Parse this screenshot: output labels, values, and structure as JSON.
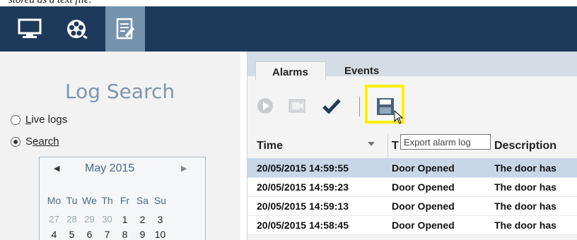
{
  "caption": {
    "text": "stored as a text file."
  },
  "toolbar_top": {
    "buttons": [
      {
        "icon": "monitor-icon"
      },
      {
        "icon": "film-reel-icon"
      },
      {
        "icon": "log-document-icon",
        "active": true
      }
    ]
  },
  "log_search": {
    "title": "Log Search",
    "live_logs_label": "ive logs",
    "live_logs_accel": "L",
    "search_label": "earch",
    "search_accel": "S",
    "selected_mode": "search"
  },
  "calendar": {
    "prev_arrow": "◀",
    "next_arrow": "▶",
    "month_label": "May 2015",
    "day_headers": [
      "Mo",
      "Tu",
      "We",
      "Th",
      "Fr",
      "Sa",
      "Su"
    ],
    "week1": [
      "27",
      "28",
      "29",
      "30",
      "1",
      "2",
      "3"
    ],
    "week2": [
      "4",
      "5",
      "6",
      "7",
      "8",
      "9",
      "10"
    ]
  },
  "tabs": [
    {
      "label": "Alarms",
      "active": true
    },
    {
      "label": "Events",
      "active": false
    }
  ],
  "alarm_toolbar": {
    "tooltip": "Export alarm log"
  },
  "grid": {
    "columns": [
      "Time",
      "T",
      "Description"
    ],
    "rows": [
      {
        "time": "20/05/2015 14:59:55",
        "type": "Door Opened",
        "description": "The door has",
        "selected": true
      },
      {
        "time": "20/05/2015 14:59:23",
        "type": "Door Opened",
        "description": "The door has",
        "selected": false
      },
      {
        "time": "20/05/2015 14:59:13",
        "type": "Door Opened",
        "description": "The door has",
        "selected": false
      },
      {
        "time": "20/05/2015 14:58:45",
        "type": "Door Opened",
        "description": "The door has",
        "selected": false
      }
    ]
  },
  "colors": {
    "topbar": "#1e3a5a",
    "active_tab": "#7593ad",
    "highlight": "#ffef00",
    "selected_row": "#c7d7e8"
  }
}
